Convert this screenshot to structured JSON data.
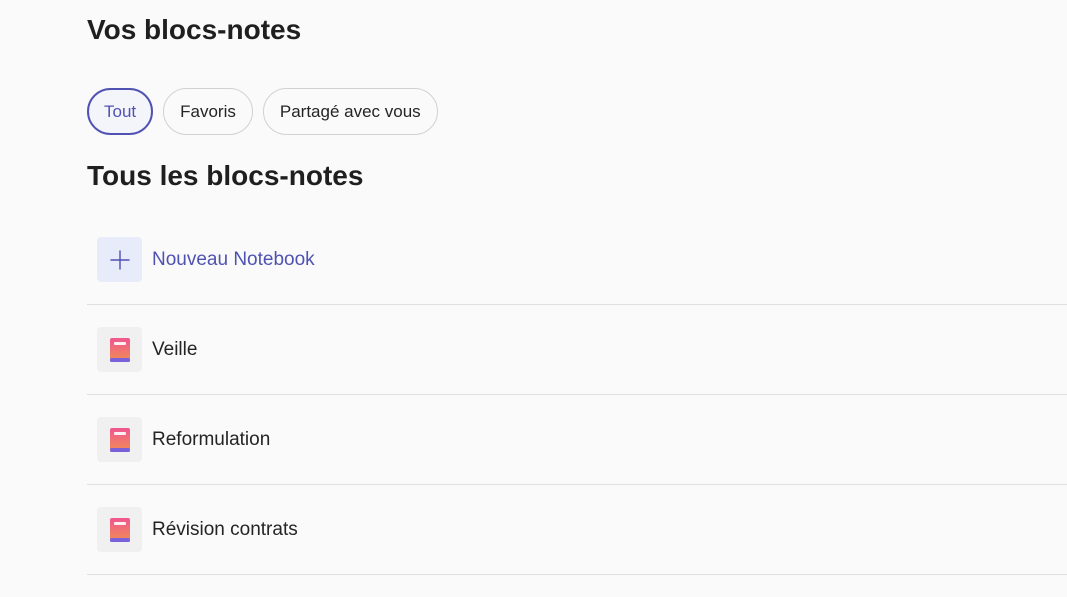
{
  "header": {
    "title": "Vos blocs-notes"
  },
  "filters": [
    {
      "label": "Tout",
      "active": true
    },
    {
      "label": "Favoris",
      "active": false
    },
    {
      "label": "Partagé avec vous",
      "active": false
    }
  ],
  "section": {
    "title": "Tous les blocs-notes"
  },
  "new_notebook": {
    "label": "Nouveau Notebook",
    "icon": "plus-icon"
  },
  "notebooks": [
    {
      "label": "Veille",
      "icon": "notebook-icon"
    },
    {
      "label": "Reformulation",
      "icon": "notebook-icon"
    },
    {
      "label": "Révision contrats",
      "icon": "notebook-icon"
    }
  ],
  "colors": {
    "accent": "#4f52b2",
    "notebook_top": "#f0568f",
    "notebook_bottom": "#f08a5a",
    "notebook_spine": "#7b61d9"
  }
}
